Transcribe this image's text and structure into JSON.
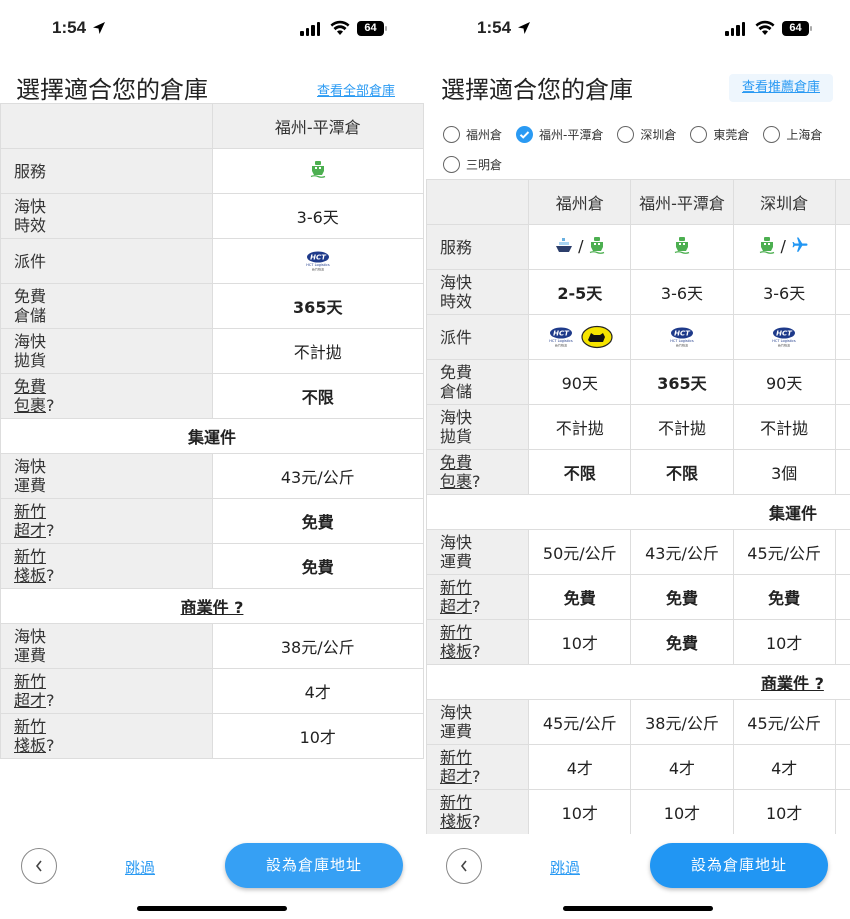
{
  "status": {
    "time": "1:54",
    "battery": "64"
  },
  "colors": {
    "accent": "#2a9af3",
    "ship": "#4caf50",
    "plane": "#2196f3"
  },
  "left": {
    "title": "選擇適合您的倉庫",
    "view_all": "查看全部倉庫",
    "column": "福州-平潭倉",
    "rows": [
      {
        "l1": "服務",
        "l2": "",
        "icons": [
          "ship-icon"
        ]
      },
      {
        "l1": "海快",
        "l2": "時效",
        "value": "3-6天"
      },
      {
        "l1": "派件",
        "l2": "",
        "icons": [
          "hct-logistics-logo"
        ]
      },
      {
        "l1": "免費",
        "l2": "倉儲",
        "value": "365天",
        "bold": true
      },
      {
        "l1": "海快",
        "l2": "拋貨",
        "value": "不計拋"
      },
      {
        "l1": "免費",
        "l2": "包裹",
        "q": "?",
        "value": "不限",
        "bold": true
      }
    ],
    "sec1": "集運件",
    "rows1": [
      {
        "l1": "海快",
        "l2": "運費",
        "value": "43元/公斤"
      },
      {
        "l1": "新竹",
        "l2": "超才",
        "q": "?",
        "value": "免費",
        "bold": true
      },
      {
        "l1": "新竹",
        "l2": "棧板",
        "q": "?",
        "value": "免費",
        "bold": true
      }
    ],
    "sec2": "商業件 ?",
    "rows2": [
      {
        "l1": "海快",
        "l2": "運費",
        "value": "38元/公斤"
      },
      {
        "l1": "新竹",
        "l2": "超才",
        "q": "?",
        "value": "4才"
      },
      {
        "l1": "新竹",
        "l2": "棧板",
        "q": "?",
        "value": "10才"
      }
    ],
    "skip": "跳過",
    "confirm": "設為倉庫地址"
  },
  "right": {
    "title": "選擇適合您的倉庫",
    "view_recommended": "查看推薦倉庫",
    "options": [
      {
        "label": "福州倉",
        "checked": false
      },
      {
        "label": "福州-平潭倉",
        "checked": true
      },
      {
        "label": "深圳倉",
        "checked": false
      },
      {
        "label": "東莞倉",
        "checked": false
      },
      {
        "label": "上海倉",
        "checked": false
      },
      {
        "label": "三明倉",
        "checked": false
      }
    ],
    "columns": [
      "福州倉",
      "福州-平潭倉",
      "深圳倉"
    ],
    "rows": [
      {
        "l1": "服務",
        "l2": "",
        "icons": [
          [
            "cruise-ship-icon",
            "ship-icon"
          ],
          [
            "ship-icon"
          ],
          [
            "ship-icon",
            "airplane-icon"
          ]
        ]
      },
      {
        "l1": "海快",
        "l2": "時效",
        "values": [
          "2-5天",
          "3-6天",
          "3-6天"
        ],
        "bold": [
          true,
          false,
          false
        ]
      },
      {
        "l1": "派件",
        "l2": "",
        "icons": [
          [
            "hct-logistics-logo",
            "black-cat-logo"
          ],
          [
            "hct-logistics-logo"
          ],
          [
            "hct-logistics-logo"
          ]
        ]
      },
      {
        "l1": "免費",
        "l2": "倉儲",
        "values": [
          "90天",
          "365天",
          "90天"
        ],
        "bold": [
          false,
          true,
          false
        ]
      },
      {
        "l1": "海快",
        "l2": "拋貨",
        "values": [
          "不計拋",
          "不計拋",
          "不計拋"
        ]
      },
      {
        "l1": "免費",
        "l2": "包裹",
        "q": "?",
        "values": [
          "不限",
          "不限",
          "3個"
        ],
        "bold": [
          true,
          true,
          false
        ]
      }
    ],
    "sec1": "集運件",
    "rows1": [
      {
        "l1": "海快",
        "l2": "運費",
        "values": [
          "50元/公斤",
          "43元/公斤",
          "45元/公斤"
        ]
      },
      {
        "l1": "新竹",
        "l2": "超才",
        "q": "?",
        "values": [
          "免費",
          "免費",
          "免費"
        ],
        "bold": [
          true,
          true,
          true
        ]
      },
      {
        "l1": "新竹",
        "l2": "棧板",
        "q": "?",
        "values": [
          "10才",
          "免費",
          "10才"
        ],
        "bold": [
          false,
          true,
          false
        ]
      }
    ],
    "sec2": "商業件 ?",
    "rows2": [
      {
        "l1": "海快",
        "l2": "運費",
        "values": [
          "45元/公斤",
          "38元/公斤",
          "45元/公斤"
        ]
      },
      {
        "l1": "新竹",
        "l2": "超才",
        "q": "?",
        "values": [
          "4才",
          "4才",
          "4才"
        ]
      },
      {
        "l1": "新竹",
        "l2": "棧板",
        "q": "?",
        "values": [
          "10才",
          "10才",
          "10才"
        ]
      }
    ],
    "skip": "跳過",
    "confirm": "設為倉庫地址"
  }
}
